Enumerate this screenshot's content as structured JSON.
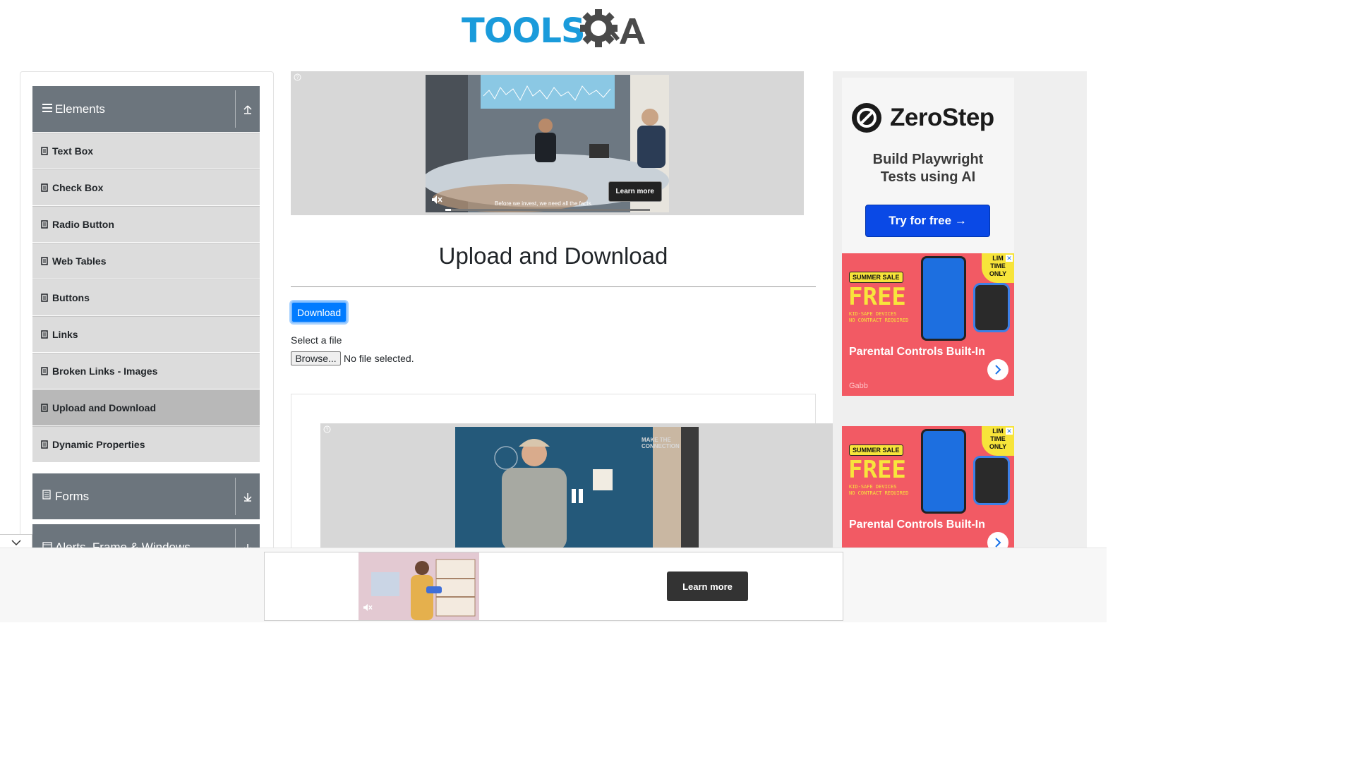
{
  "logo": {
    "part1": "TOOLS",
    "part2": "QA"
  },
  "sidebar": {
    "elements_header": "Elements",
    "items": [
      {
        "label": "Text Box"
      },
      {
        "label": "Check Box"
      },
      {
        "label": "Radio Button"
      },
      {
        "label": "Web Tables"
      },
      {
        "label": "Buttons"
      },
      {
        "label": "Links"
      },
      {
        "label": "Broken Links - Images"
      },
      {
        "label": "Upload and Download",
        "active": true
      },
      {
        "label": "Dynamic Properties"
      }
    ],
    "forms_header": "Forms",
    "alerts_header": "Alerts, Frame & Windows"
  },
  "ad_top": {
    "learn_more": "Learn more",
    "caption": "Before we invest, we need all the facts."
  },
  "main": {
    "title": "Upload and Download",
    "download_label": "Download",
    "select_label": "Select a file",
    "browse_label": "Browse...",
    "file_status": "No file selected."
  },
  "ad_mid": {
    "overlay_text": "MAKE THE CONNECTION"
  },
  "zerostep": {
    "brand": "ZeroStep",
    "tagline_1": "Build Playwright",
    "tagline_2": "Tests using AI",
    "cta": "Try for free →"
  },
  "gabb_ad": {
    "sale": "SUMMER SALE",
    "free": "FREE",
    "sub_1": "KID-SAFE DEVICES",
    "sub_2": "NO CONTRACT REQUIRED",
    "limited_1": "LIM",
    "limited_2": "TIME",
    "limited_3": "ONLY",
    "headline": "Parental Controls Built-In",
    "brand": "Gabb"
  },
  "bottom_ad": {
    "learn_more": "Learn more"
  },
  "colors": {
    "accent": "#007bff",
    "sidebar_header": "#6c757d",
    "sidebar_item": "#dcdcdc",
    "logo_blue": "#1a9bdb",
    "gabb_red": "#f25a64",
    "zerostep_blue": "#0a49e6"
  }
}
